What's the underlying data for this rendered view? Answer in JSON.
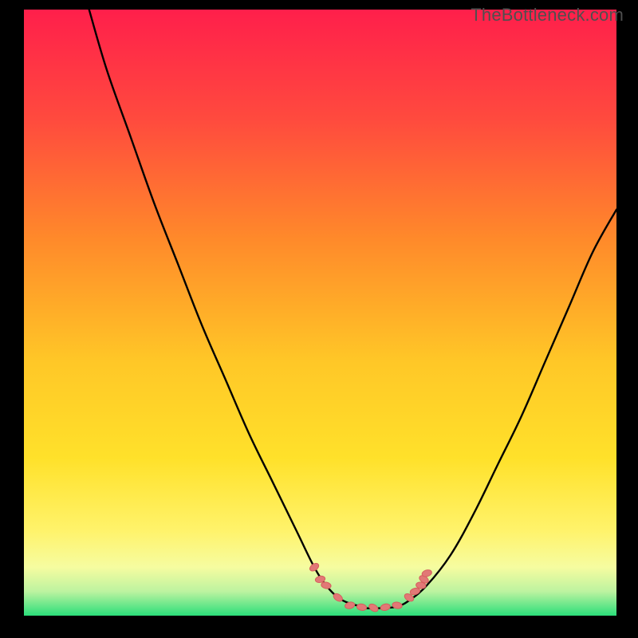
{
  "attribution": "TheBottleneck.com",
  "colors": {
    "gradient_top": "#ff1f4b",
    "gradient_mid_upper": "#ff8a2a",
    "gradient_mid": "#ffe12a",
    "gradient_lower": "#fff98c",
    "gradient_bottom": "#2bde7a",
    "curve": "#000000",
    "marker_fill": "#e27876",
    "marker_stroke": "#d65f5d",
    "frame": "#000000"
  },
  "chart_data": {
    "type": "line",
    "title": "",
    "xlabel": "",
    "ylabel": "",
    "xlim": [
      0,
      100
    ],
    "ylim": [
      0,
      100
    ],
    "series": [
      {
        "name": "bottleneck-curve-left",
        "x": [
          11,
          14,
          18,
          22,
          26,
          30,
          34,
          38,
          42,
          46,
          49,
          51,
          53,
          55,
          57
        ],
        "y": [
          100,
          90,
          79,
          68,
          58,
          48,
          39,
          30,
          22,
          14,
          8,
          5,
          3,
          2,
          1.5
        ]
      },
      {
        "name": "bottleneck-curve-right",
        "x": [
          63,
          65,
          68,
          72,
          76,
          80,
          84,
          88,
          92,
          96,
          100
        ],
        "y": [
          1.5,
          2.5,
          5,
          10,
          17,
          25,
          33,
          42,
          51,
          60,
          67
        ]
      },
      {
        "name": "optimal-flat",
        "x": [
          55,
          57,
          59,
          61,
          63
        ],
        "y": [
          1.5,
          1.3,
          1.2,
          1.3,
          1.5
        ]
      }
    ],
    "markers": {
      "name": "highlight-points",
      "points": [
        {
          "x": 49,
          "y": 8
        },
        {
          "x": 50,
          "y": 6
        },
        {
          "x": 51,
          "y": 5
        },
        {
          "x": 53,
          "y": 3
        },
        {
          "x": 55,
          "y": 1.7
        },
        {
          "x": 57,
          "y": 1.4
        },
        {
          "x": 59,
          "y": 1.3
        },
        {
          "x": 61,
          "y": 1.4
        },
        {
          "x": 63,
          "y": 1.7
        },
        {
          "x": 65,
          "y": 3
        },
        {
          "x": 66,
          "y": 4
        },
        {
          "x": 67,
          "y": 5
        },
        {
          "x": 67.5,
          "y": 6
        },
        {
          "x": 68,
          "y": 7
        }
      ]
    }
  }
}
